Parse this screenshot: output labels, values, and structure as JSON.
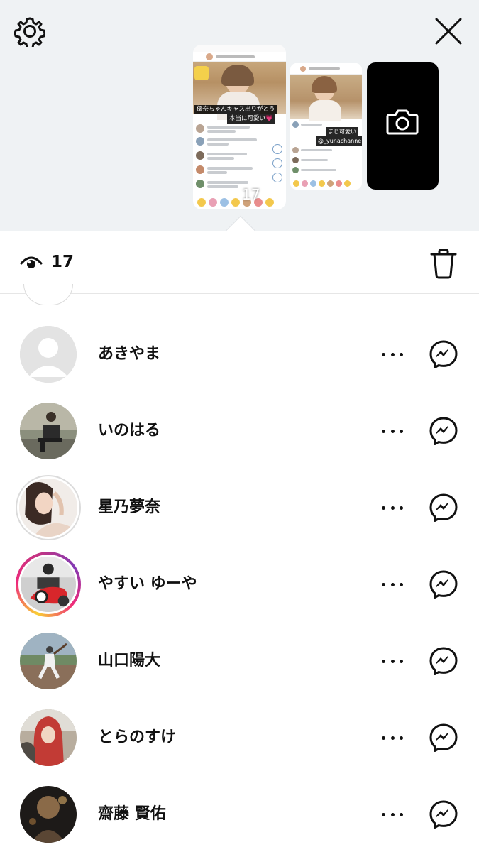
{
  "tray": {
    "settings_icon": "gear-icon",
    "close_icon": "close-icon",
    "camera_icon": "camera-icon",
    "thumbnail_main": {
      "caption_top": "優奈ちゃんキャス出りがとう",
      "caption_bottom": "本当に可愛い💗",
      "viewer_count": "17"
    },
    "thumbnail_second": {
      "caption_top": "まじ可愛い",
      "caption_bottom": "@_yunachannel"
    }
  },
  "header": {
    "eye_icon": "eye-icon",
    "viewer_count": "17",
    "trash_icon": "trash-icon"
  },
  "viewers": [
    {
      "name": "あきやま",
      "avatar": "default-avatar",
      "ring": "none"
    },
    {
      "name": "いのはる",
      "avatar": "photo-sitting-person",
      "ring": "none"
    },
    {
      "name": "星乃夢奈",
      "avatar": "photo-woman-portrait",
      "ring": "seen"
    },
    {
      "name": "やすい ゆーや",
      "avatar": "photo-motorbike",
      "ring": "story"
    },
    {
      "name": "山口陽大",
      "avatar": "photo-baseball",
      "ring": "none"
    },
    {
      "name": "とらのすけ",
      "avatar": "photo-hoodie",
      "ring": "none"
    },
    {
      "name": "齋藤 賢佑",
      "avatar": "photo-dark-portrait",
      "ring": "none"
    }
  ],
  "row_actions": {
    "more_icon": "more-icon",
    "messenger_icon": "messenger-icon"
  }
}
